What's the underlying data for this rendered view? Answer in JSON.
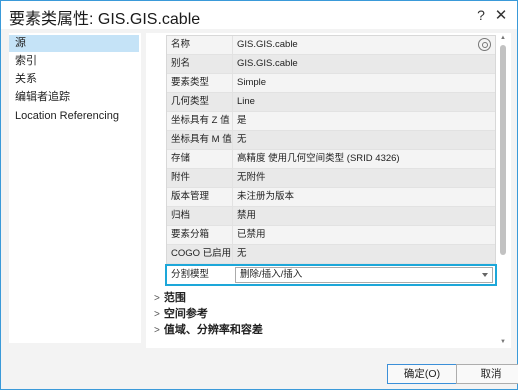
{
  "window": {
    "title": "要素类属性: GIS.GIS.cable",
    "help_icon": "question-mark",
    "close_icon": "close-x"
  },
  "sidebar": {
    "items": [
      {
        "label": "源",
        "selected": true
      },
      {
        "label": "索引",
        "selected": false
      },
      {
        "label": "关系",
        "selected": false
      },
      {
        "label": "编辑者追踪",
        "selected": false
      },
      {
        "label": "Location Referencing",
        "selected": false
      }
    ]
  },
  "properties": [
    {
      "key": "名称",
      "value": "GIS.GIS.cable"
    },
    {
      "key": "别名",
      "value": "GIS.GIS.cable"
    },
    {
      "key": "要素类型",
      "value": "Simple"
    },
    {
      "key": "几何类型",
      "value": "Line"
    },
    {
      "key": "坐标具有 Z 值",
      "value": "是"
    },
    {
      "key": "坐标具有 M 值",
      "value": "无"
    },
    {
      "key": "存储",
      "value": "高精度 使用几何空间类型 (SRID 4326)"
    },
    {
      "key": "附件",
      "value": "无附件"
    },
    {
      "key": "版本管理",
      "value": "未注册为版本"
    },
    {
      "key": "归档",
      "value": "禁用"
    },
    {
      "key": "要素分箱",
      "value": "已禁用"
    },
    {
      "key": "COGO 已启用",
      "value": "无"
    }
  ],
  "split_model": {
    "key": "分割模型",
    "value": "删除/插入/插入"
  },
  "sections": [
    {
      "label": "范围",
      "expanded": false
    },
    {
      "label": "空间参考",
      "expanded": false
    },
    {
      "label": "值域、分辨率和容差",
      "expanded": false
    }
  ],
  "buttons": {
    "ok": "确定(O)",
    "cancel": "取消"
  },
  "colors": {
    "highlight_border": "#1da7d9",
    "selected_nav": "#c5e3f7",
    "window_border": "#3a9ad9"
  }
}
